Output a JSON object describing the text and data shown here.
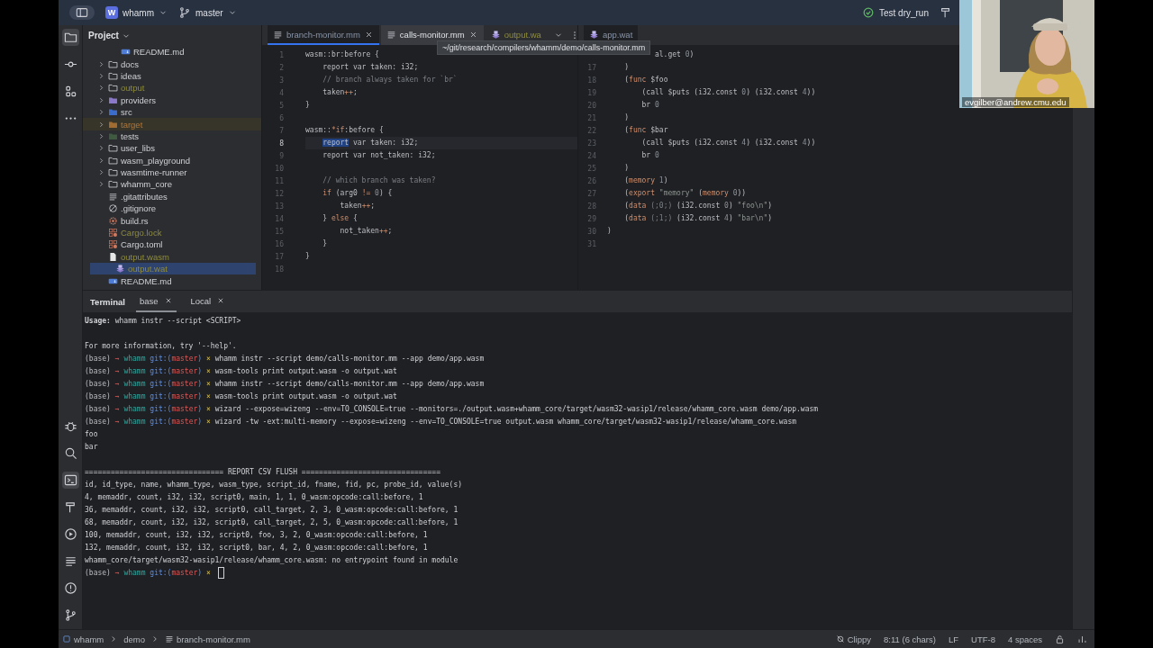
{
  "title_bar": {
    "project_badge": "W",
    "project": "whamm",
    "branch": "master",
    "run_config": "Test dry_run"
  },
  "tool_strip": {
    "top": [
      {
        "kind": "folder",
        "selected": true
      },
      {
        "kind": "commit",
        "selected": false
      },
      {
        "kind": "structure",
        "selected": false
      },
      {
        "kind": "more",
        "selected": false
      }
    ],
    "bottom": [
      {
        "kind": "bug",
        "selected": false
      },
      {
        "kind": "search",
        "selected": false
      },
      {
        "kind": "terminal",
        "selected": true
      },
      {
        "kind": "build",
        "selected": false
      },
      {
        "kind": "run",
        "selected": false
      },
      {
        "kind": "list",
        "selected": false
      },
      {
        "kind": "problems",
        "selected": false
      },
      {
        "kind": "git",
        "selected": false
      }
    ]
  },
  "project_panel": {
    "title": "Project",
    "tree": [
      {
        "children": [
          {
            "label": "README.md",
            "kind": "md",
            "ignored": false,
            "excluded": false,
            "selected": false
          }
        ]
      },
      {
        "label": "docs",
        "kind": "folder",
        "expanded": false,
        "ignored": false,
        "excluded": false,
        "selected": false
      },
      {
        "label": "ideas",
        "kind": "folder",
        "expanded": false,
        "ignored": false,
        "excluded": false,
        "selected": false
      },
      {
        "label": "output",
        "kind": "folder",
        "expanded": false,
        "ignored": true,
        "excluded": false,
        "selected": false
      },
      {
        "label": "providers",
        "kind": "folder-res",
        "expanded": false,
        "ignored": false,
        "excluded": false,
        "selected": false
      },
      {
        "label": "src",
        "kind": "folder-src",
        "expanded": false,
        "ignored": false,
        "excluded": false,
        "selected": false
      },
      {
        "label": "target",
        "kind": "folder-excluded",
        "expanded": false,
        "ignored": false,
        "excluded": true,
        "selected": false
      },
      {
        "label": "tests",
        "kind": "folder-test",
        "expanded": false,
        "ignored": false,
        "excluded": false,
        "selected": false
      },
      {
        "label": "user_libs",
        "kind": "folder",
        "expanded": false,
        "ignored": false,
        "excluded": false,
        "selected": false
      },
      {
        "label": "wasm_playground",
        "kind": "folder",
        "expanded": false,
        "ignored": false,
        "excluded": false,
        "selected": false
      },
      {
        "label": "wasmtime-runner",
        "kind": "folder",
        "expanded": false,
        "ignored": false,
        "excluded": false,
        "selected": false
      },
      {
        "label": "whamm_core",
        "kind": "folder",
        "expanded": false,
        "ignored": false,
        "excluded": false,
        "selected": false
      },
      {
        "label": ".gitattributes",
        "kind": "textfile",
        "ignored": false,
        "excluded": false,
        "selected": false
      },
      {
        "label": ".gitignore",
        "kind": "ignore",
        "ignored": false,
        "excluded": false,
        "selected": false
      },
      {
        "label": "build.rs",
        "kind": "rust",
        "ignored": false,
        "excluded": false,
        "selected": false
      },
      {
        "label": "Cargo.lock",
        "kind": "cargo",
        "ignored": true,
        "excluded": false,
        "selected": false
      },
      {
        "label": "Cargo.toml",
        "kind": "cargo",
        "ignored": false,
        "excluded": false,
        "selected": false
      },
      {
        "label": "output.wasm",
        "kind": "file",
        "ignored": true,
        "excluded": false,
        "selected": false
      },
      {
        "label": "output.wat",
        "kind": "wat",
        "ignored": true,
        "excluded": false,
        "selected": true
      },
      {
        "label": "README.md",
        "kind": "md",
        "ignored": false,
        "excluded": false,
        "selected": false
      }
    ]
  },
  "editor_left": {
    "tabs": [
      {
        "label": "branch-monitor.mm",
        "kind": "textfile",
        "ignored": false,
        "selected": true,
        "hovered": false,
        "closable": true
      },
      {
        "label": "calls-monitor.mm",
        "kind": "textfile",
        "ignored": false,
        "selected": false,
        "hovered": true,
        "closable": true
      },
      {
        "label": "output.wa",
        "kind": "wat",
        "ignored": true,
        "selected": false,
        "hovered": false,
        "closable": false
      }
    ],
    "lines": [
      {
        "number": "1",
        "current": false,
        "code": [
          {
            "text": "wasm::br:before {",
            "kind": "plain"
          }
        ]
      },
      {
        "number": "2",
        "current": false,
        "code": [
          {
            "text": "    report var taken: i32;",
            "kind": "plain"
          }
        ]
      },
      {
        "number": "3",
        "current": false,
        "code": [
          {
            "text": "    // branch always taken for `br`",
            "kind": "comment"
          }
        ]
      },
      {
        "number": "4",
        "current": false,
        "code": [
          {
            "text": "    taken",
            "kind": "plain"
          },
          {
            "text": "++",
            "kind": "keyword"
          },
          {
            "text": ";",
            "kind": "plain"
          }
        ]
      },
      {
        "number": "5",
        "current": false,
        "code": [
          {
            "text": "}",
            "kind": "plain"
          }
        ]
      },
      {
        "number": "6",
        "current": false
      },
      {
        "number": "7",
        "current": false,
        "code": [
          {
            "text": "wasm::",
            "kind": "plain"
          },
          {
            "text": "*if",
            "kind": "keyword"
          },
          {
            "text": ":before {",
            "kind": "plain"
          }
        ]
      },
      {
        "number": "8",
        "current": true,
        "code": [
          {
            "text": "    report",
            "kind": "selection"
          },
          {
            "text": " var taken: i32;",
            "kind": "plain"
          }
        ]
      },
      {
        "number": "9",
        "current": false,
        "code": [
          {
            "text": "    report var not_taken: i32;",
            "kind": "plain"
          }
        ]
      },
      {
        "number": "10",
        "current": false
      },
      {
        "number": "11",
        "current": false,
        "code": [
          {
            "text": "    // which branch was taken?",
            "kind": "comment"
          }
        ]
      },
      {
        "number": "12",
        "current": false,
        "code": [
          {
            "text": "    if",
            "kind": "keyword"
          },
          {
            "text": " (arg0 ",
            "kind": "plain"
          },
          {
            "text": "!=",
            "kind": "keyword"
          },
          {
            "text": " 0",
            "kind": "number"
          },
          {
            "text": ") {",
            "kind": "plain"
          }
        ]
      },
      {
        "number": "13",
        "current": false,
        "code": [
          {
            "text": "        taken",
            "kind": "plain"
          },
          {
            "text": "++",
            "kind": "keyword"
          },
          {
            "text": ";",
            "kind": "plain"
          }
        ]
      },
      {
        "number": "14",
        "current": false,
        "code": [
          {
            "text": "    } ",
            "kind": "plain"
          },
          {
            "text": "else",
            "kind": "keyword"
          },
          {
            "text": " {",
            "kind": "plain"
          }
        ]
      },
      {
        "number": "15",
        "current": false,
        "code": [
          {
            "text": "        not_taken",
            "kind": "plain"
          },
          {
            "text": "++",
            "kind": "keyword"
          },
          {
            "text": ";",
            "kind": "plain"
          }
        ]
      },
      {
        "number": "16",
        "current": false,
        "code": [
          {
            "text": "    }",
            "kind": "plain"
          }
        ]
      },
      {
        "number": "17",
        "current": false,
        "code": [
          {
            "text": "}",
            "kind": "plain"
          }
        ]
      },
      {
        "number": "18",
        "current": false
      }
    ]
  },
  "tooltip": "~/git/research/compilers/whamm/demo/calls-monitor.mm",
  "editor_right": {
    "tabs": [
      {
        "label": "app.wat",
        "kind": "wat",
        "ignored": false,
        "selected": true,
        "hovered": false,
        "closable": false
      }
    ],
    "lines": [
      {
        "code": [
          {
            "text": "           al.get",
            "kind": "plain"
          },
          {
            "text": " 0",
            "kind": "number"
          },
          {
            "text": ")",
            "kind": "plain"
          }
        ]
      },
      {
        "number": "17",
        "code": [
          {
            "text": "    )",
            "kind": "plain"
          }
        ]
      },
      {
        "number": "18",
        "code": [
          {
            "text": "    (",
            "kind": "plain"
          },
          {
            "text": "func",
            "kind": "keyword"
          },
          {
            "text": " $foo",
            "kind": "plain"
          }
        ]
      },
      {
        "number": "19",
        "code": [
          {
            "text": "        (call $puts (i32.const ",
            "kind": "plain"
          },
          {
            "text": "0",
            "kind": "number"
          },
          {
            "text": ") (i32.const ",
            "kind": "plain"
          },
          {
            "text": "4",
            "kind": "number"
          },
          {
            "text": "))",
            "kind": "plain"
          }
        ]
      },
      {
        "number": "20",
        "code": [
          {
            "text": "        br",
            "kind": "plain"
          },
          {
            "text": " 0",
            "kind": "number"
          }
        ]
      },
      {
        "number": "21",
        "code": [
          {
            "text": "    )",
            "kind": "plain"
          }
        ]
      },
      {
        "number": "22",
        "code": [
          {
            "text": "    (",
            "kind": "plain"
          },
          {
            "text": "func",
            "kind": "keyword"
          },
          {
            "text": " $bar",
            "kind": "plain"
          }
        ]
      },
      {
        "number": "23",
        "code": [
          {
            "text": "        (call $puts (i32.const ",
            "kind": "plain"
          },
          {
            "text": "4",
            "kind": "number"
          },
          {
            "text": ") (i32.const ",
            "kind": "plain"
          },
          {
            "text": "4",
            "kind": "number"
          },
          {
            "text": "))",
            "kind": "plain"
          }
        ]
      },
      {
        "number": "24",
        "code": [
          {
            "text": "        br",
            "kind": "plain"
          },
          {
            "text": " 0",
            "kind": "number"
          }
        ]
      },
      {
        "number": "25",
        "code": [
          {
            "text": "    )",
            "kind": "plain"
          }
        ]
      },
      {
        "number": "26",
        "code": [
          {
            "text": "    (",
            "kind": "plain"
          },
          {
            "text": "memory",
            "kind": "keyword"
          },
          {
            "text": " 1",
            "kind": "number"
          },
          {
            "text": ")",
            "kind": "plain"
          }
        ]
      },
      {
        "number": "27",
        "code": [
          {
            "text": "    (",
            "kind": "plain"
          },
          {
            "text": "export",
            "kind": "keyword"
          },
          {
            "text": " \"memory\"",
            "kind": "string"
          },
          {
            "text": " (",
            "kind": "plain"
          },
          {
            "text": "memory",
            "kind": "keyword"
          },
          {
            "text": " 0",
            "kind": "number"
          },
          {
            "text": "))",
            "kind": "plain"
          }
        ]
      },
      {
        "number": "28",
        "code": [
          {
            "text": "    (",
            "kind": "plain"
          },
          {
            "text": "data",
            "kind": "keyword"
          },
          {
            "text": " (;0;)",
            "kind": "comment"
          },
          {
            "text": " (i32.const ",
            "kind": "plain"
          },
          {
            "text": "0",
            "kind": "number"
          },
          {
            "text": ") ",
            "kind": "plain"
          },
          {
            "text": "\"foo\\n\"",
            "kind": "string"
          },
          {
            "text": ")",
            "kind": "plain"
          }
        ]
      },
      {
        "number": "29",
        "code": [
          {
            "text": "    (",
            "kind": "plain"
          },
          {
            "text": "data",
            "kind": "keyword"
          },
          {
            "text": " (;1;)",
            "kind": "comment"
          },
          {
            "text": " (i32.const ",
            "kind": "plain"
          },
          {
            "text": "4",
            "kind": "number"
          },
          {
            "text": ") ",
            "kind": "plain"
          },
          {
            "text": "\"bar\\n\"",
            "kind": "string"
          },
          {
            "text": ")",
            "kind": "plain"
          }
        ]
      },
      {
        "number": "30",
        "code": [
          {
            "text": ")",
            "kind": "plain"
          }
        ]
      },
      {
        "number": "31"
      }
    ]
  },
  "terminal": {
    "title": "Terminal",
    "tabs": [
      {
        "label": "base",
        "selected": true
      },
      {
        "label": "Local",
        "selected": false
      }
    ],
    "lines": [
      {
        "kind": "text",
        "text": "**Usage:** whamm instr --script <SCRIPT>"
      },
      {
        "kind": "blank"
      },
      {
        "kind": "text",
        "text": "For more information, try '--help'."
      },
      {
        "kind": "prompt",
        "env": "(base)",
        "arrow": "→",
        "dir": "whamm",
        "git_open": "git:(",
        "branch": "master",
        "git_close": ")",
        "dirty": "×",
        "command": "whamm instr --script demo/calls-monitor.mm --app demo/app.wasm",
        "cursor": false
      },
      {
        "kind": "prompt",
        "env": "(base)",
        "arrow": "→",
        "dir": "whamm",
        "git_open": "git:(",
        "branch": "master",
        "git_close": ")",
        "dirty": "×",
        "command": "wasm-tools print output.wasm -o output.wat",
        "cursor": false
      },
      {
        "kind": "prompt",
        "env": "(base)",
        "arrow": "→",
        "dir": "whamm",
        "git_open": "git:(",
        "branch": "master",
        "git_close": ")",
        "dirty": "×",
        "command": "whamm instr --script demo/calls-monitor.mm --app demo/app.wasm",
        "cursor": false
      },
      {
        "kind": "prompt",
        "env": "(base)",
        "arrow": "→",
        "dir": "whamm",
        "git_open": "git:(",
        "branch": "master",
        "git_close": ")",
        "dirty": "×",
        "command": "wasm-tools print output.wasm -o output.wat",
        "cursor": false
      },
      {
        "kind": "prompt",
        "env": "(base)",
        "arrow": "→",
        "dir": "whamm",
        "git_open": "git:(",
        "branch": "master",
        "git_close": ")",
        "dirty": "×",
        "command": "wizard --expose=wizeng --env=TO_CONSOLE=true --monitors=./output.wasm+whamm_core/target/wasm32-wasip1/release/whamm_core.wasm demo/app.wasm",
        "cursor": false
      },
      {
        "kind": "prompt",
        "env": "(base)",
        "arrow": "→",
        "dir": "whamm",
        "git_open": "git:(",
        "branch": "master",
        "git_close": ")",
        "dirty": "×",
        "command": "wizard -tw -ext:multi-memory --expose=wizeng --env=TO_CONSOLE=true output.wasm whamm_core/target/wasm32-wasip1/release/whamm_core.wasm",
        "cursor": false
      },
      {
        "kind": "text",
        "text": "foo"
      },
      {
        "kind": "text",
        "text": "bar"
      },
      {
        "kind": "blank"
      },
      {
        "kind": "text",
        "text": "================================ REPORT CSV FLUSH ================================"
      },
      {
        "kind": "text",
        "text": "id, id_type, name, whamm_type, wasm_type, script_id, fname, fid, pc, probe_id, value(s)"
      },
      {
        "kind": "text",
        "text": "4, memaddr, count, i32, i32, script0, main, 1, 1, 0_wasm:opcode:call:before, 1"
      },
      {
        "kind": "text",
        "text": "36, memaddr, count, i32, i32, script0, call_target, 2, 3, 0_wasm:opcode:call:before, 1"
      },
      {
        "kind": "text",
        "text": "68, memaddr, count, i32, i32, script0, call_target, 2, 5, 0_wasm:opcode:call:before, 1"
      },
      {
        "kind": "text",
        "text": "100, memaddr, count, i32, i32, script0, foo, 3, 2, 0_wasm:opcode:call:before, 1"
      },
      {
        "kind": "text",
        "text": "132, memaddr, count, i32, i32, script0, bar, 4, 2, 0_wasm:opcode:call:before, 1"
      },
      {
        "kind": "text",
        "text": "whamm_core/target/wasm32-wasip1/release/whamm_core.wasm: no entrypoint found in module"
      },
      {
        "kind": "prompt",
        "env": "(base)",
        "arrow": "→",
        "dir": "whamm",
        "git_open": "git:(",
        "branch": "master",
        "git_close": ")",
        "dirty": "×",
        "cursor": true
      }
    ]
  },
  "status_bar": {
    "breadcrumbs": [
      {
        "label": "whamm",
        "kind": "module"
      },
      {
        "label": "demo",
        "kind": "plain"
      },
      {
        "label": "branch-monitor.mm",
        "kind": "textfile"
      }
    ],
    "items": [
      {
        "label": "Clippy",
        "kind": "clippy"
      },
      {
        "label": "8:11 (6 chars)",
        "kind": "plain"
      },
      {
        "label": "LF",
        "kind": "plain"
      },
      {
        "label": "UTF-8",
        "kind": "plain"
      },
      {
        "label": "4 spaces",
        "kind": "plain"
      }
    ]
  },
  "video": {
    "kind": "picture",
    "participant": "evgilber@andrew.cmu.edu"
  }
}
